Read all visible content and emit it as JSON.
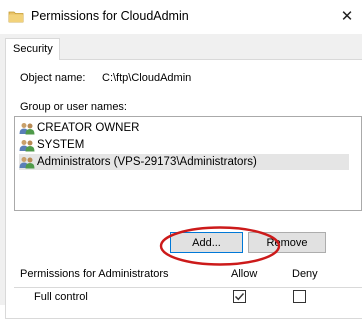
{
  "window": {
    "title": "Permissions for CloudAdmin",
    "close_glyph": "✕"
  },
  "tabs": [
    {
      "label": "Security",
      "selected": true
    }
  ],
  "object": {
    "label": "Object name:",
    "value": "C:\\ftp\\CloudAdmin"
  },
  "group": {
    "label": "Group or user names:",
    "items": [
      {
        "name": "CREATOR OWNER",
        "icon": "users-icon",
        "selected": false
      },
      {
        "name": "SYSTEM",
        "icon": "users-icon",
        "selected": false
      },
      {
        "name": "Administrators (VPS-29173\\Administrators)",
        "icon": "users-icon",
        "selected": true
      }
    ]
  },
  "buttons": {
    "add": "Add...",
    "remove": "Remove"
  },
  "permissions": {
    "header": "Permissions for Administrators",
    "allow_label": "Allow",
    "deny_label": "Deny",
    "rows": [
      {
        "name": "Full control",
        "allow": true,
        "deny": false
      }
    ]
  },
  "colors": {
    "highlight_ellipse": "#cc1a1a",
    "focus_border": "#0078d7"
  }
}
